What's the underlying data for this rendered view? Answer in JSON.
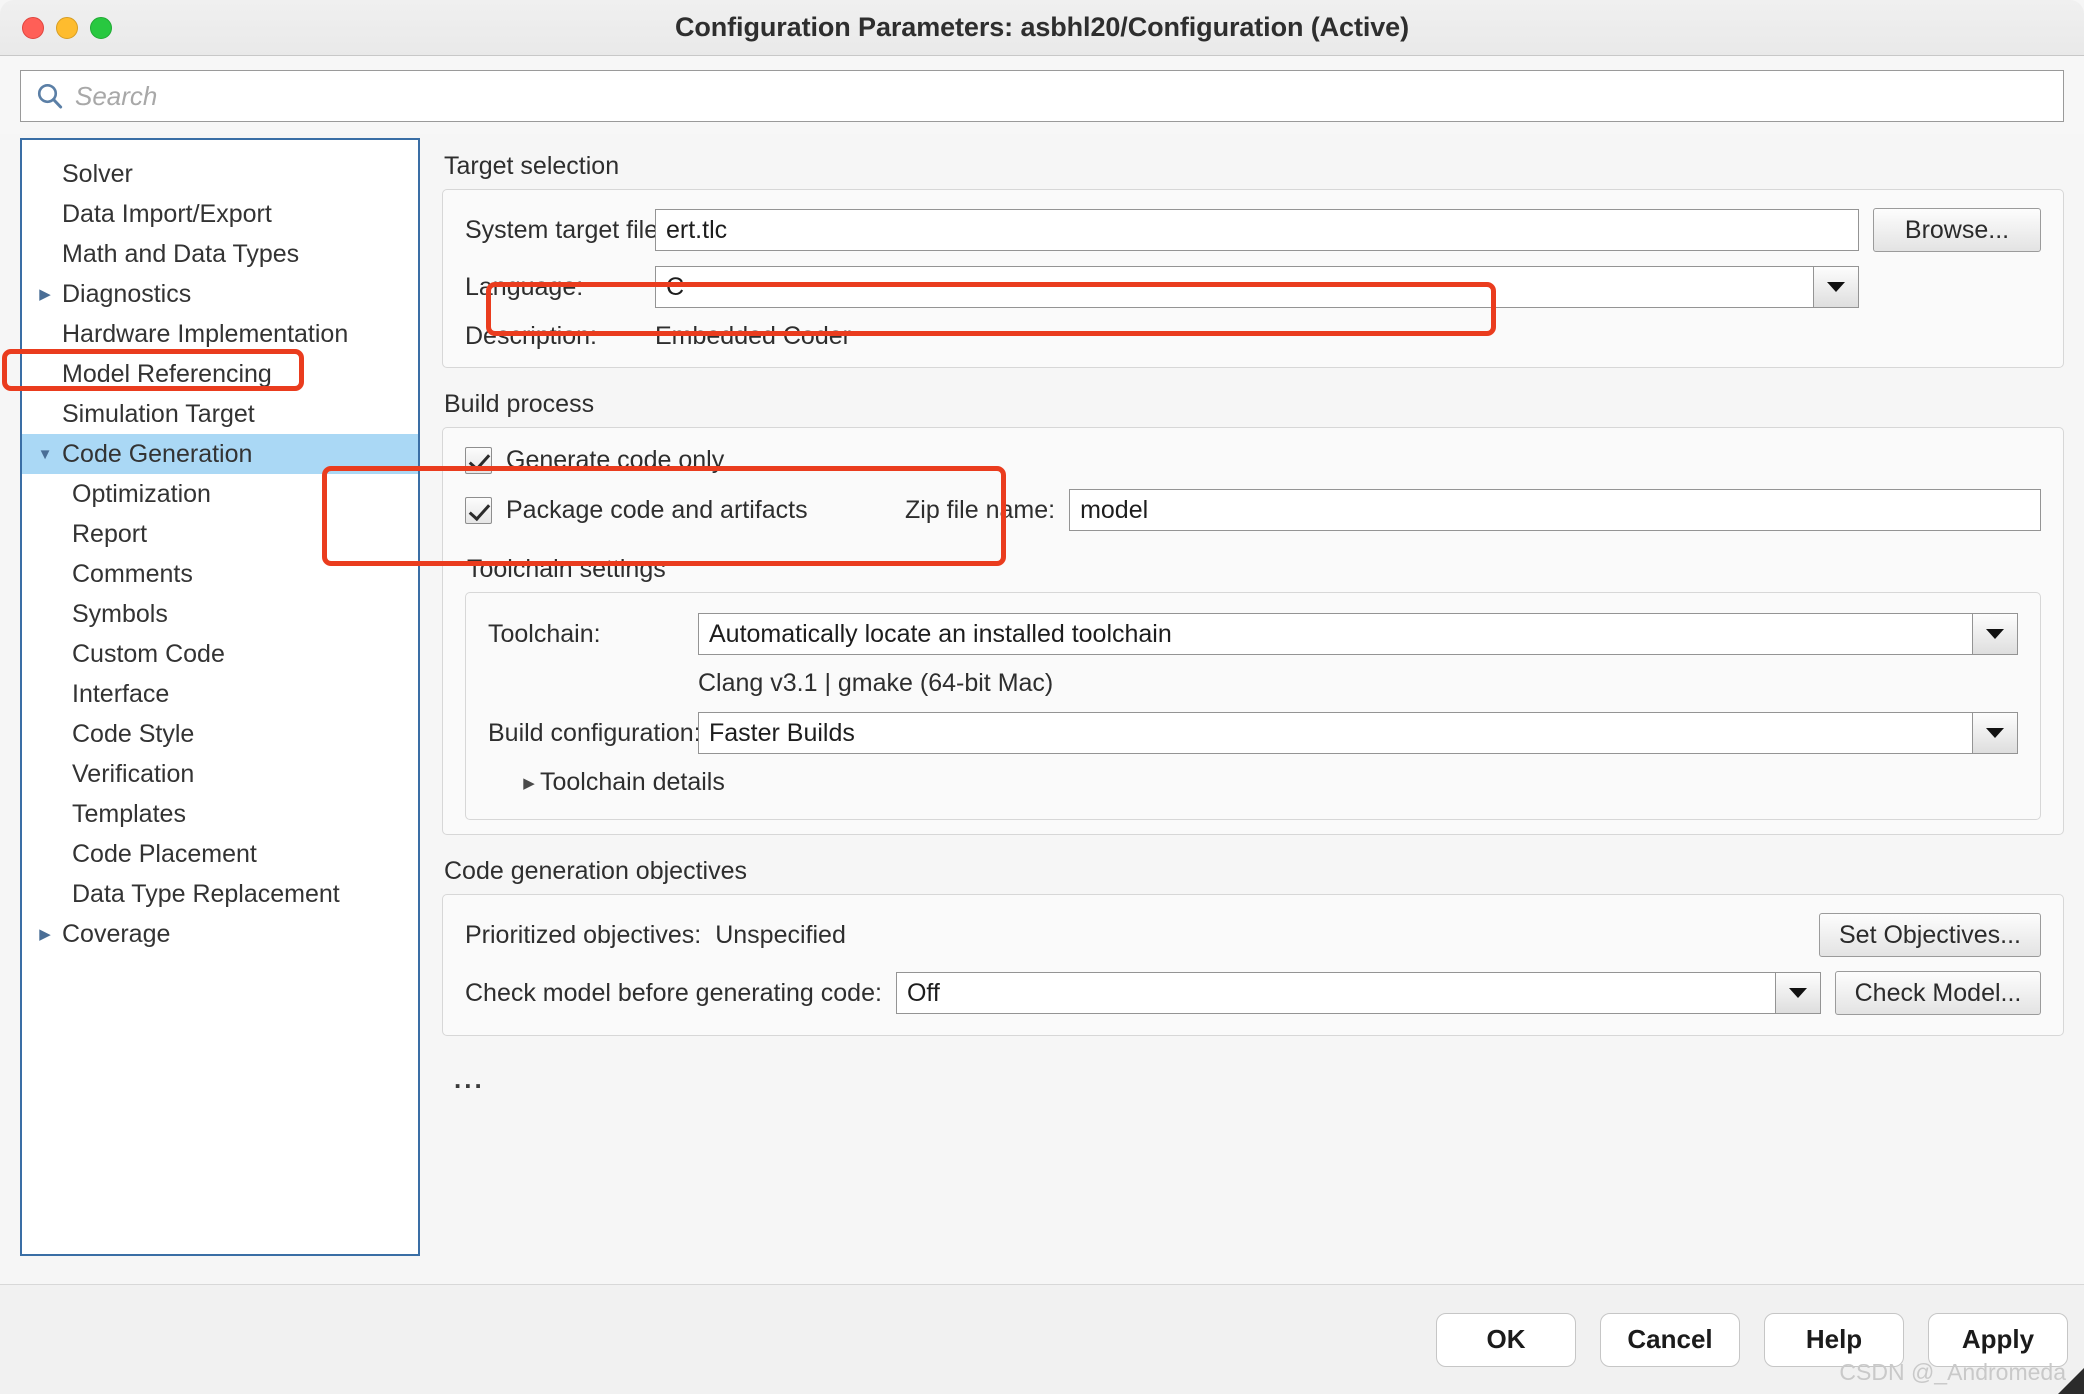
{
  "window": {
    "title": "Configuration Parameters: asbhl20/Configuration (Active)",
    "traffic_lights": [
      "close",
      "minimize",
      "zoom"
    ]
  },
  "search": {
    "placeholder": "Search",
    "value": "",
    "icon": "search-icon"
  },
  "tree": {
    "items": [
      {
        "label": "Solver",
        "depth": 0,
        "twisty": "",
        "selected": false
      },
      {
        "label": "Data Import/Export",
        "depth": 0,
        "twisty": "",
        "selected": false
      },
      {
        "label": "Math and Data Types",
        "depth": 0,
        "twisty": "",
        "selected": false
      },
      {
        "label": "Diagnostics",
        "depth": 0,
        "twisty": "▶",
        "selected": false
      },
      {
        "label": "Hardware Implementation",
        "depth": 0,
        "twisty": "",
        "selected": false
      },
      {
        "label": "Model Referencing",
        "depth": 0,
        "twisty": "",
        "selected": false
      },
      {
        "label": "Simulation Target",
        "depth": 0,
        "twisty": "",
        "selected": false
      },
      {
        "label": "Code Generation",
        "depth": 0,
        "twisty": "▼",
        "selected": true
      },
      {
        "label": "Optimization",
        "depth": 1,
        "twisty": "",
        "selected": false
      },
      {
        "label": "Report",
        "depth": 1,
        "twisty": "",
        "selected": false
      },
      {
        "label": "Comments",
        "depth": 1,
        "twisty": "",
        "selected": false
      },
      {
        "label": "Symbols",
        "depth": 1,
        "twisty": "",
        "selected": false
      },
      {
        "label": "Custom Code",
        "depth": 1,
        "twisty": "",
        "selected": false
      },
      {
        "label": "Interface",
        "depth": 1,
        "twisty": "",
        "selected": false
      },
      {
        "label": "Code Style",
        "depth": 1,
        "twisty": "",
        "selected": false
      },
      {
        "label": "Verification",
        "depth": 1,
        "twisty": "",
        "selected": false
      },
      {
        "label": "Templates",
        "depth": 1,
        "twisty": "",
        "selected": false
      },
      {
        "label": "Code Placement",
        "depth": 1,
        "twisty": "",
        "selected": false
      },
      {
        "label": "Data Type Replacement",
        "depth": 1,
        "twisty": "",
        "selected": false
      },
      {
        "label": "Coverage",
        "depth": 0,
        "twisty": "▶",
        "selected": false
      }
    ]
  },
  "target_selection": {
    "section_label": "Target selection",
    "system_target_file_label": "System target file:",
    "system_target_file_value": "ert.tlc",
    "browse_label": "Browse...",
    "language_label": "Language:",
    "language_value": "C",
    "description_label": "Description:",
    "description_value": "Embedded Coder"
  },
  "build_process": {
    "section_label": "Build process",
    "generate_code_only_label": "Generate code only",
    "generate_code_only_checked": true,
    "package_code_label": "Package code and artifacts",
    "package_code_checked": true,
    "zip_file_name_label": "Zip file name:",
    "zip_file_name_value": "model"
  },
  "toolchain_settings": {
    "section_label": "Toolchain settings",
    "toolchain_label": "Toolchain:",
    "toolchain_value": "Automatically locate an installed toolchain",
    "toolchain_info": "Clang v3.1 | gmake (64-bit Mac)",
    "build_configuration_label": "Build configuration:",
    "build_configuration_value": "Faster Builds",
    "toolchain_details_label": "Toolchain details",
    "toolchain_details_twisty": "▶"
  },
  "code_generation_objectives": {
    "section_label": "Code generation objectives",
    "prioritized_objectives_label": "Prioritized objectives:",
    "prioritized_objectives_value": "Unspecified",
    "set_objectives_label": "Set Objectives...",
    "check_model_label": "Check model before generating code:",
    "check_model_value": "Off",
    "check_model_button_label": "Check Model..."
  },
  "overflow_indicator": "...",
  "footer": {
    "ok_label": "OK",
    "cancel_label": "Cancel",
    "help_label": "Help",
    "apply_label": "Apply"
  },
  "watermark": "CSDN @_Andromeda",
  "colors": {
    "highlight_annotation": "#ea3c1e",
    "tree_selection": "#aad8f5",
    "tree_border": "#3a6ea5",
    "search_icon": "#5b7fa6"
  }
}
